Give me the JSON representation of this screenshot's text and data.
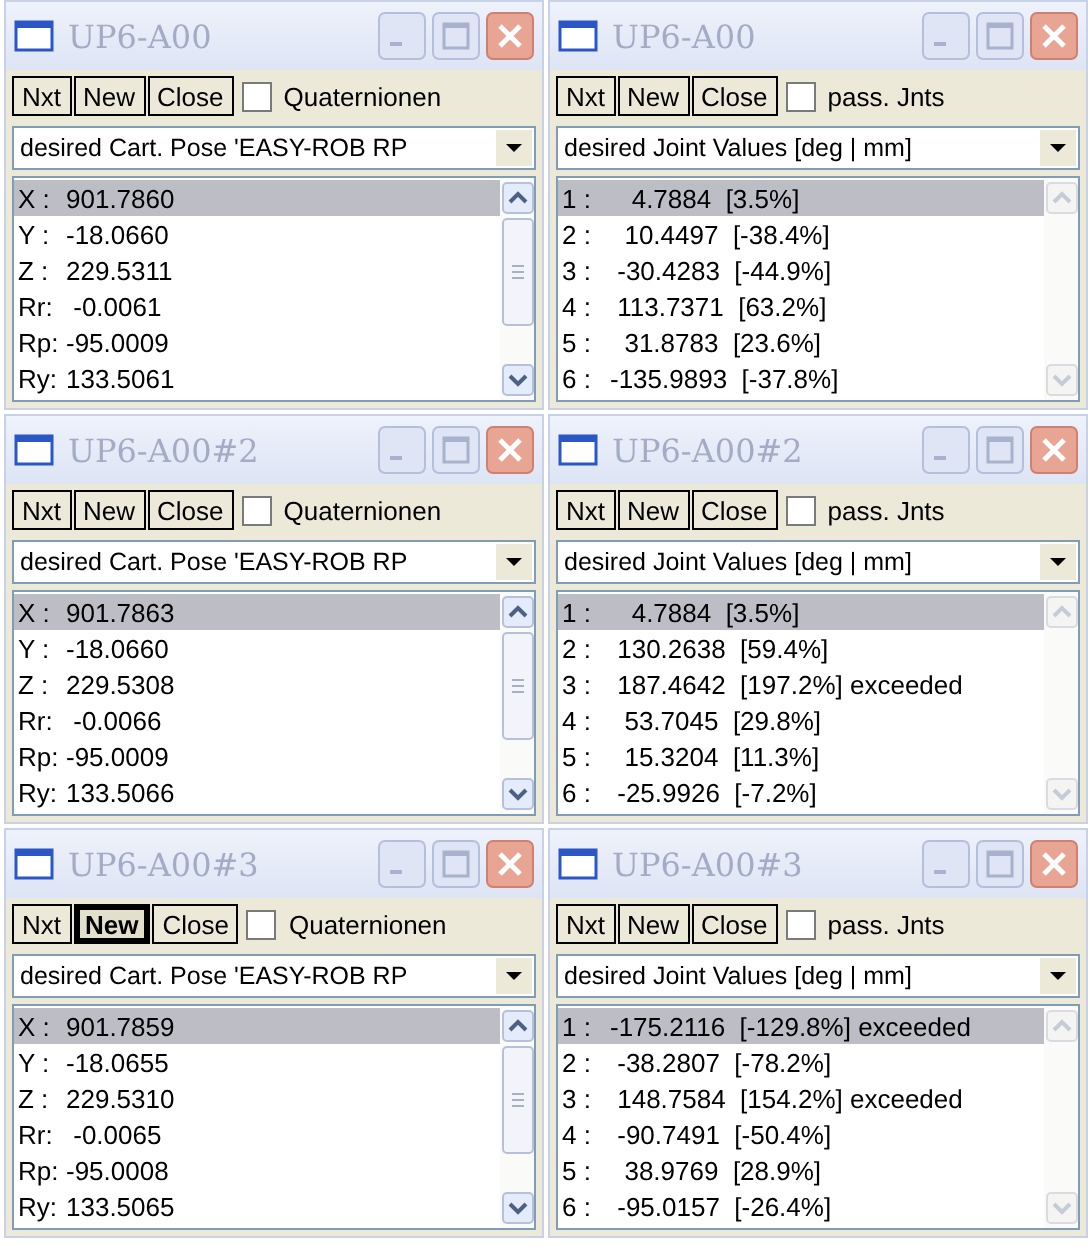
{
  "windows": [
    {
      "title": "UP6-A00",
      "buttons": [
        {
          "label": "Nxt",
          "focused": false
        },
        {
          "label": "New",
          "focused": false
        },
        {
          "label": "Close",
          "focused": false
        }
      ],
      "option": {
        "label": "Quaternionen",
        "checked": false
      },
      "dropdown": "desired Cart. Pose 'EASY-ROB RP",
      "scrollbar": {
        "disabled": false
      },
      "rows": [
        {
          "label": "X :",
          "value": "901.7860",
          "selected": true
        },
        {
          "label": "Y :",
          "value": "-18.0660",
          "selected": false
        },
        {
          "label": "Z :",
          "value": "229.5311",
          "selected": false
        },
        {
          "label": "Rr:",
          "value": " -0.0061",
          "selected": false
        },
        {
          "label": "Rp:",
          "value": "-95.0009",
          "selected": false
        },
        {
          "label": "Ry:",
          "value": "133.5061",
          "selected": false
        }
      ]
    },
    {
      "title": "UP6-A00",
      "buttons": [
        {
          "label": "Nxt",
          "focused": false
        },
        {
          "label": "New",
          "focused": false
        },
        {
          "label": "Close",
          "focused": false
        }
      ],
      "option": {
        "label": "pass. Jnts",
        "checked": false
      },
      "dropdown": "desired Joint Values [deg | mm]",
      "scrollbar": {
        "disabled": true
      },
      "rows": [
        {
          "label": "1 :",
          "value": "   4.7884  [3.5%]",
          "selected": true
        },
        {
          "label": "2 :",
          "value": "  10.4497  [-38.4%]",
          "selected": false
        },
        {
          "label": "3 :",
          "value": " -30.4283  [-44.9%]",
          "selected": false
        },
        {
          "label": "4 :",
          "value": " 113.7371  [63.2%]",
          "selected": false
        },
        {
          "label": "5 :",
          "value": "  31.8783  [23.6%]",
          "selected": false
        },
        {
          "label": "6 :",
          "value": "-135.9893  [-37.8%]",
          "selected": false
        }
      ]
    },
    {
      "title": "UP6-A00#2",
      "buttons": [
        {
          "label": "Nxt",
          "focused": false
        },
        {
          "label": "New",
          "focused": false
        },
        {
          "label": "Close",
          "focused": false
        }
      ],
      "option": {
        "label": "Quaternionen",
        "checked": false
      },
      "dropdown": "desired Cart. Pose 'EASY-ROB RP",
      "scrollbar": {
        "disabled": false
      },
      "rows": [
        {
          "label": "X :",
          "value": "901.7863",
          "selected": true
        },
        {
          "label": "Y :",
          "value": "-18.0660",
          "selected": false
        },
        {
          "label": "Z :",
          "value": "229.5308",
          "selected": false
        },
        {
          "label": "Rr:",
          "value": " -0.0066",
          "selected": false
        },
        {
          "label": "Rp:",
          "value": "-95.0009",
          "selected": false
        },
        {
          "label": "Ry:",
          "value": "133.5066",
          "selected": false
        }
      ]
    },
    {
      "title": "UP6-A00#2",
      "buttons": [
        {
          "label": "Nxt",
          "focused": false
        },
        {
          "label": "New",
          "focused": false
        },
        {
          "label": "Close",
          "focused": false
        }
      ],
      "option": {
        "label": "pass. Jnts",
        "checked": false
      },
      "dropdown": "desired Joint Values [deg | mm]",
      "scrollbar": {
        "disabled": true
      },
      "rows": [
        {
          "label": "1 :",
          "value": "   4.7884  [3.5%]",
          "selected": true
        },
        {
          "label": "2 :",
          "value": " 130.2638  [59.4%]",
          "selected": false
        },
        {
          "label": "3 :",
          "value": " 187.4642  [197.2%] exceeded",
          "selected": false
        },
        {
          "label": "4 :",
          "value": "  53.7045  [29.8%]",
          "selected": false
        },
        {
          "label": "5 :",
          "value": "  15.3204  [11.3%]",
          "selected": false
        },
        {
          "label": "6 :",
          "value": " -25.9926  [-7.2%]",
          "selected": false
        }
      ]
    },
    {
      "title": "UP6-A00#3",
      "buttons": [
        {
          "label": "Nxt",
          "focused": false
        },
        {
          "label": "New",
          "focused": true
        },
        {
          "label": "Close",
          "focused": false
        }
      ],
      "option": {
        "label": "Quaternionen",
        "checked": false
      },
      "dropdown": "desired Cart. Pose 'EASY-ROB RP",
      "scrollbar": {
        "disabled": false
      },
      "rows": [
        {
          "label": "X :",
          "value": "901.7859",
          "selected": true
        },
        {
          "label": "Y :",
          "value": "-18.0655",
          "selected": false
        },
        {
          "label": "Z :",
          "value": "229.5310",
          "selected": false
        },
        {
          "label": "Rr:",
          "value": " -0.0065",
          "selected": false
        },
        {
          "label": "Rp:",
          "value": "-95.0008",
          "selected": false
        },
        {
          "label": "Ry:",
          "value": "133.5065",
          "selected": false
        }
      ]
    },
    {
      "title": "UP6-A00#3",
      "buttons": [
        {
          "label": "Nxt",
          "focused": false
        },
        {
          "label": "New",
          "focused": false
        },
        {
          "label": "Close",
          "focused": false
        }
      ],
      "option": {
        "label": "pass. Jnts",
        "checked": false
      },
      "dropdown": "desired Joint Values [deg | mm]",
      "scrollbar": {
        "disabled": true
      },
      "rows": [
        {
          "label": "1 :",
          "value": "-175.2116  [-129.8%] exceeded",
          "selected": true
        },
        {
          "label": "2 :",
          "value": " -38.2807  [-78.2%]",
          "selected": false
        },
        {
          "label": "3 :",
          "value": " 148.7584  [154.2%] exceeded",
          "selected": false
        },
        {
          "label": "4 :",
          "value": " -90.7491  [-50.4%]",
          "selected": false
        },
        {
          "label": "5 :",
          "value": "  38.9769  [28.9%]",
          "selected": false
        },
        {
          "label": "6 :",
          "value": " -95.0157  [-26.4%]",
          "selected": false
        }
      ]
    }
  ]
}
